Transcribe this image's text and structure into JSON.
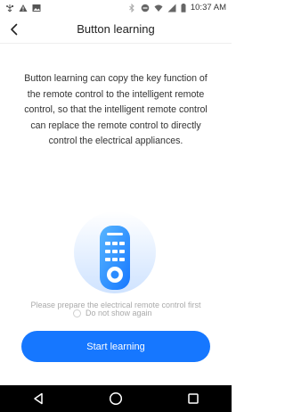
{
  "status_bar": {
    "time": "10:37 AM",
    "icons_left": [
      "usb-icon",
      "alert-icon",
      "image-icon"
    ],
    "icons_right": [
      "bluetooth-icon",
      "do-not-disturb-icon",
      "wifi-icon",
      "signal-icon",
      "battery-icon"
    ]
  },
  "header": {
    "title": "Button learning",
    "back_icon": "chevron-left-icon"
  },
  "description": "Button learning can copy the key function of the remote control to the intelligent remote control, so that the intelligent remote control can replace the remote control to directly control the electrical appliances.",
  "illustration": {
    "icon": "remote-control-icon"
  },
  "hint": "Please prepare the electrical remote control first",
  "dont_show": {
    "label": "Do not show again",
    "checked": false
  },
  "start_button": {
    "label": "Start learning"
  },
  "colors": {
    "accent": "#1677ff",
    "text": "#333333",
    "muted": "#aaaaaa"
  },
  "nav_bar": {
    "icons": [
      "back-triangle-icon",
      "home-circle-icon",
      "recents-square-icon"
    ]
  }
}
